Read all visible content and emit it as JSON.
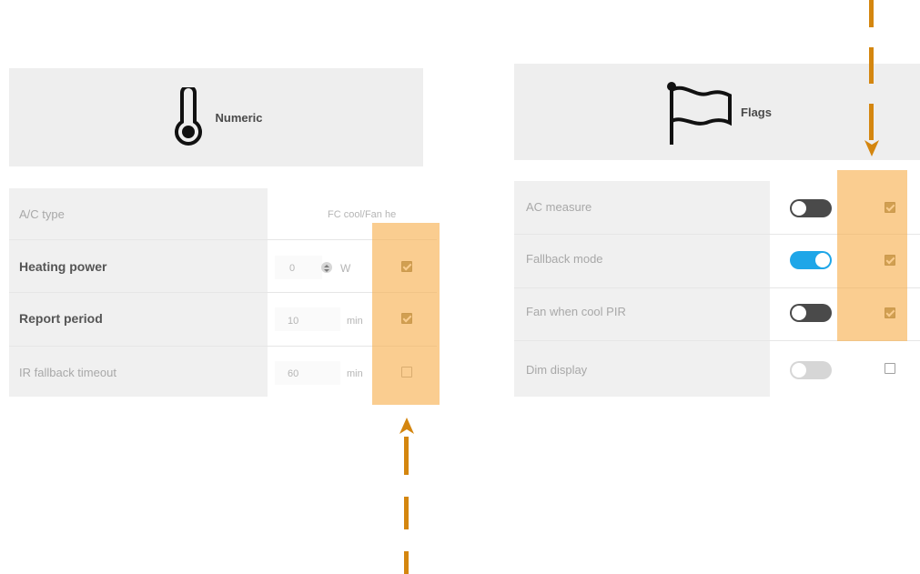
{
  "numeric": {
    "title": "Numeric",
    "icon": "thermometer-icon",
    "rows": [
      {
        "label": "A/C type",
        "value": "FC cool/Fan he",
        "unit": "",
        "checked": null
      },
      {
        "label": "Heating power",
        "value": "0",
        "unit": "W",
        "checked": true
      },
      {
        "label": "Report period",
        "value": "10",
        "unit": "min",
        "checked": true
      },
      {
        "label": "IR fallback timeout",
        "value": "60",
        "unit": "min",
        "checked": false
      }
    ]
  },
  "flags": {
    "title": "Flags",
    "icon": "flag-icon",
    "rows": [
      {
        "label": "AC measure",
        "toggle": "off",
        "checked": true
      },
      {
        "label": "Fallback mode",
        "toggle": "on",
        "checked": true
      },
      {
        "label": "Fan when cool PIR",
        "toggle": "off",
        "checked": true
      },
      {
        "label": "Dim display",
        "toggle": "disabled",
        "checked": false
      }
    ]
  },
  "annotations": {
    "highlight_color": "#f8b254",
    "arrow_color": "#d4860f"
  }
}
